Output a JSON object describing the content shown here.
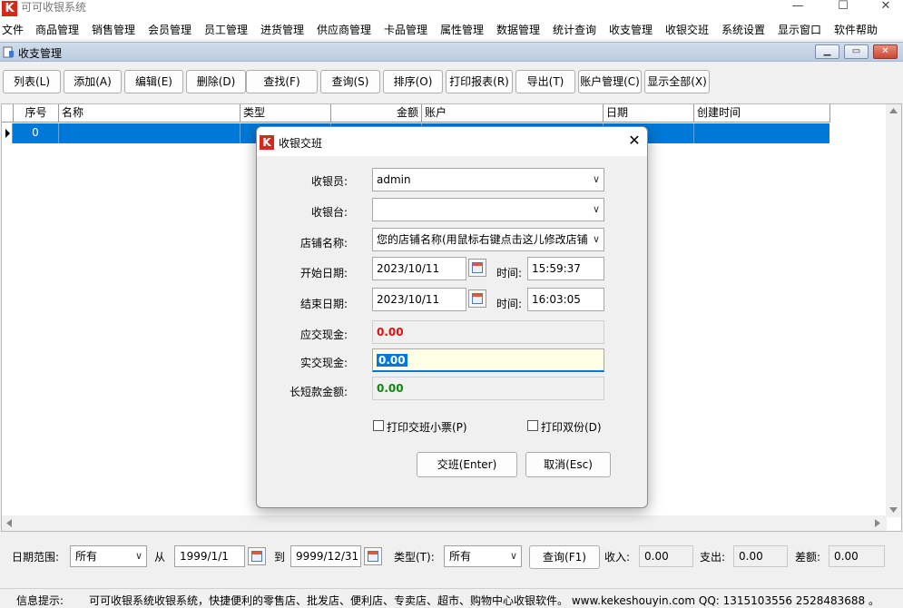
{
  "window": {
    "title": "可可收银系统",
    "buttons": [
      "—",
      "☐",
      "✕"
    ]
  },
  "menu": [
    "文件",
    "商品管理",
    "销售管理",
    "会员管理",
    "员工管理",
    "进货管理",
    "供应商管理",
    "卡品管理",
    "属性管理",
    "数据管理",
    "统计查询",
    "收支管理",
    "收银交班",
    "系统设置",
    "显示窗口",
    "软件帮助"
  ],
  "child": {
    "title": "收支管理"
  },
  "toolbar": [
    "列表(L)",
    "添加(A)",
    "编辑(E)",
    "删除(D)",
    "查找(F)",
    "查询(S)",
    "排序(O)",
    "打印报表(R)",
    "导出(T)",
    "账户管理(C)",
    "显示全部(X)"
  ],
  "grid": {
    "columns": [
      "序号",
      "名称",
      "类型",
      "金额",
      "账户",
      "日期",
      "创建时间"
    ],
    "rows": [
      {
        "seq": "0"
      }
    ]
  },
  "filter": {
    "date_range_label": "日期范围:",
    "date_range_value": "所有",
    "from_label": "从",
    "from_value": "1999/1/1",
    "to_label": "到",
    "to_value": "9999/12/31",
    "type_label": "类型(T):",
    "type_value": "所有",
    "query_button": "查询(F1)",
    "income_label": "收入:",
    "income_value": "0.00",
    "expense_label": "支出:",
    "expense_value": "0.00",
    "diff_label": "差额:",
    "diff_value": "0.00"
  },
  "status": {
    "label": "信息提示:",
    "message": "可可收银系统收银系统，快捷便利的零售店、批发店、便利店、专卖店、超市、购物中心收银软件。  www.kekeshouyin.com  QQ: 1315103556 2528483688 。"
  },
  "dialog": {
    "title": "收银交班",
    "cashier_label": "收银员:",
    "cashier_value": "admin",
    "register_label": "收银台:",
    "register_value": "",
    "store_label": "店铺名称:",
    "store_value": "您的店铺名称(用鼠标右键点击这儿修改店铺",
    "start_date_label": "开始日期:",
    "start_date_value": "2023/10/11",
    "start_time_label": "时间:",
    "start_time_value": "15:59:37",
    "end_date_label": "结束日期:",
    "end_date_value": "2023/10/11",
    "end_time_label": "时间:",
    "end_time_value": "16:03:05",
    "due_cash_label": "应交现金:",
    "due_cash_value": "0.00",
    "actual_cash_label": "实交现金:",
    "actual_cash_value": "0.00",
    "diff_label": "长短款金额:",
    "diff_value": "0.00",
    "print_receipt_label": "打印交班小票(P)",
    "print_double_label": "打印双份(D)",
    "confirm_button": "交班(Enter)",
    "cancel_button": "取消(Esc)"
  },
  "colors": {
    "selection": "#0078d7",
    "due_cash": "#e01010",
    "diff": "#0a8a0a",
    "actual_cash_bg": "#ffffe6"
  }
}
